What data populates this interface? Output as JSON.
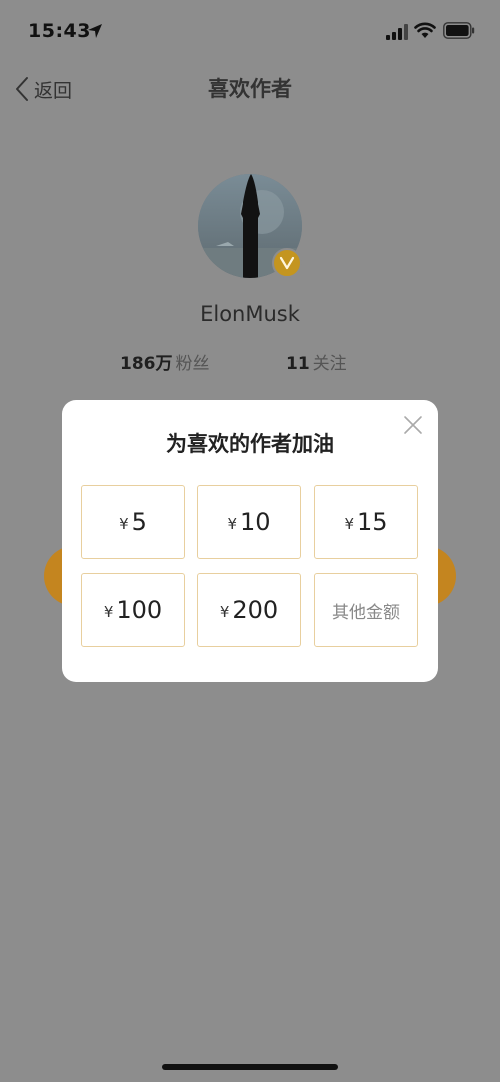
{
  "status_bar": {
    "time": "15:43"
  },
  "nav": {
    "back_label": "返回",
    "title": "喜欢作者"
  },
  "profile": {
    "username": "ElonMusk",
    "fans_count": "186万",
    "fans_label": "粉丝",
    "follow_count": "11",
    "follow_label": "关注"
  },
  "modal": {
    "title": "为喜欢的作者加油",
    "currency_symbol": "¥",
    "amounts": [
      "5",
      "10",
      "15",
      "100",
      "200"
    ],
    "other_label": "其他金额"
  },
  "colors": {
    "overlay": "#8d8d8d",
    "accent_gold": "#c4951f",
    "button_border": "#e8cf9e"
  }
}
